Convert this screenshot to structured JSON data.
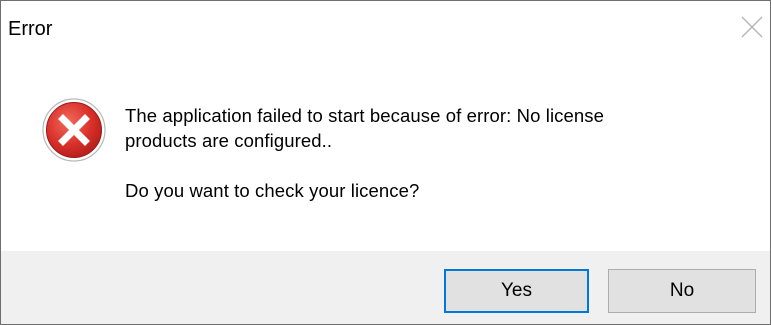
{
  "dialog": {
    "title": "Error",
    "close_icon": "close-icon",
    "status_icon": "error-icon",
    "message_line1": "The application failed to start because of error: No license",
    "message_line2": "products are configured..",
    "question": "Do you want to check your licence?",
    "buttons": {
      "yes_label": "Yes",
      "no_label": "No"
    }
  },
  "colors": {
    "error_red": "#d32f2f",
    "footer_bg": "#f0f0f0",
    "button_bg": "#e1e1e1",
    "focus_border": "#0078d7"
  }
}
